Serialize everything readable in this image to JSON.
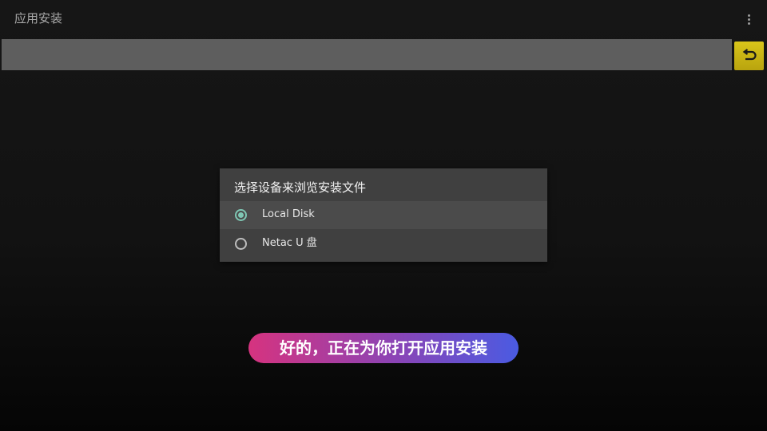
{
  "titlebar": {
    "title": "应用安装",
    "menu_icon": "more-vert-icon"
  },
  "path_bar": {
    "value": "",
    "back_icon": "return-arrow-icon",
    "back_color": "#c9b514"
  },
  "dialog": {
    "title": "选择设备来浏览安装文件",
    "options": [
      {
        "label": "Local Disk",
        "selected": true
      },
      {
        "label": "Netac U 盘",
        "selected": false
      }
    ],
    "accent": "#7fc7b4"
  },
  "assistant": {
    "message": "好的，正在为你打开应用安装",
    "gradient": [
      "#d6337f",
      "#8a44b6",
      "#4a5be2"
    ]
  }
}
